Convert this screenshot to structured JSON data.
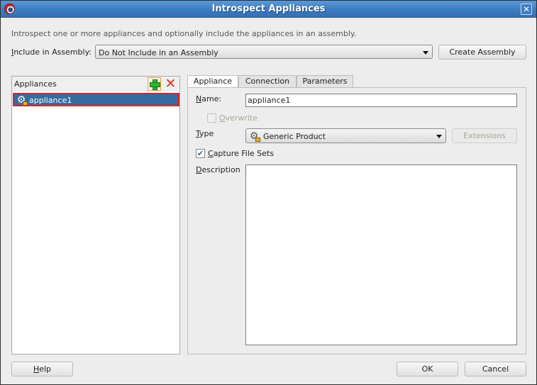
{
  "window": {
    "title": "Introspect Appliances",
    "close_glyph": "✕"
  },
  "intro_text": "Introspect one or more appliances and optionally include the appliances in an assembly.",
  "assembly": {
    "label_mnemonic": "I",
    "label_rest": "nclude in Assembly:",
    "selected": "Do Not Include in an Assembly",
    "create_button": "Create Assembly"
  },
  "appliances": {
    "header": "Appliances",
    "add_tooltip_icon": "add-icon",
    "remove_glyph": "✕",
    "items": [
      {
        "label": "appliance1",
        "selected": true
      }
    ]
  },
  "tabs": [
    {
      "label": "Appliance",
      "active": true
    },
    {
      "label": "Connection",
      "active": false
    },
    {
      "label": "Parameters",
      "active": false
    }
  ],
  "form": {
    "name_mnemonic": "N",
    "name_rest": "ame:",
    "name_value": "appliance1",
    "overwrite_mnemonic": "O",
    "overwrite_rest": "verwrite",
    "overwrite_checked": false,
    "overwrite_enabled": false,
    "type_mnemonic": "T",
    "type_rest": "ype",
    "type_value": "Generic Product",
    "extensions_button": "Extensions",
    "capture_mnemonic": "C",
    "capture_rest": "apture File Sets",
    "capture_checked": true,
    "capture_check_glyph": "✔",
    "description_mnemonic": "D",
    "description_rest": "escription",
    "description_value": ""
  },
  "footer": {
    "help_mnemonic": "H",
    "help_rest": "elp",
    "ok": "OK",
    "cancel": "Cancel"
  },
  "icons": {
    "gear": "⚙"
  }
}
